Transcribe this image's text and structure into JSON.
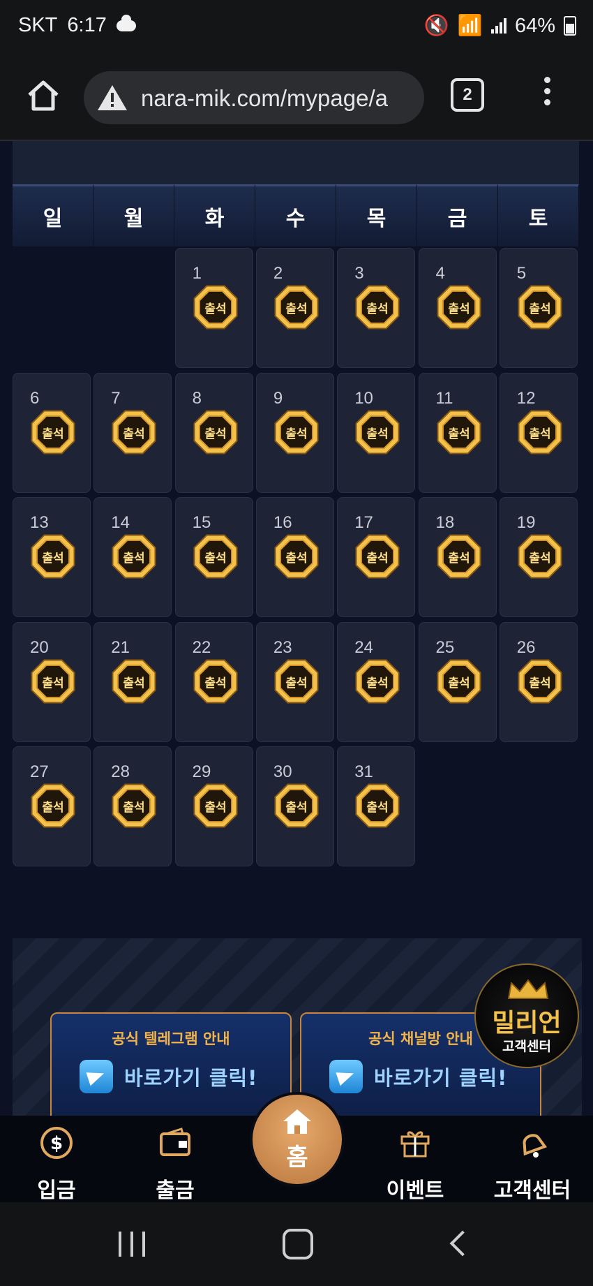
{
  "status_bar": {
    "carrier": "SKT",
    "time": "6:17",
    "battery": "64%"
  },
  "browser": {
    "url": "nara-mik.com/mypage/a",
    "tab_count": "2"
  },
  "calendar": {
    "weekdays": [
      "일",
      "월",
      "화",
      "수",
      "목",
      "금",
      "토"
    ],
    "first_weekday_index": 2,
    "badge_text": "출석",
    "days": [
      "1",
      "2",
      "3",
      "4",
      "5",
      "6",
      "7",
      "8",
      "9",
      "10",
      "11",
      "12",
      "13",
      "14",
      "15",
      "16",
      "17",
      "18",
      "19",
      "20",
      "21",
      "22",
      "23",
      "24",
      "25",
      "26",
      "27",
      "28",
      "29",
      "30",
      "31"
    ]
  },
  "promos": [
    {
      "title": "공식 텔레그램 안내",
      "button": "바로가기 클릭!"
    },
    {
      "title": "공식 채널방 안내",
      "button": "바로가기 클릭!"
    }
  ],
  "cs_badge": {
    "brand": "밀리언",
    "label": "고객센터"
  },
  "bottom_nav": {
    "deposit": "입금",
    "withdraw": "출금",
    "home": "홈",
    "event": "이벤트",
    "support": "고객센터"
  },
  "colors": {
    "gold": "#f4c24a",
    "accent": "#c9853a",
    "background": "#0c1123"
  }
}
